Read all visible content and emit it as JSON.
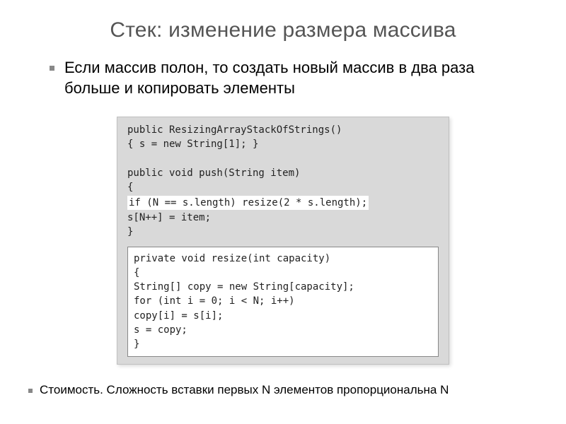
{
  "title": "Стек: изменение размера массива",
  "bullet1": "Если массив полон, то создать новый массив в два раза больше и копировать элементы",
  "code": {
    "line1": "public ResizingArrayStackOfStrings()",
    "line2": "{   s = new String[1];  }",
    "line3": "public void push(String item)",
    "line4": "{",
    "line5": "   if (N == s.length)  resize(2 * s.length);",
    "line6": "   s[N++] = item;",
    "line7": "}",
    "r1": "private void resize(int capacity)",
    "r2": "{",
    "r3": "   String[] copy = new String[capacity];",
    "r4": "   for (int i = 0; i < N; i++)",
    "r5": "      copy[i] = s[i];",
    "r6": "   s = copy;",
    "r7": "}"
  },
  "bullet2": "Стоимость. Сложность вставки первых N элементов пропорциональна N"
}
